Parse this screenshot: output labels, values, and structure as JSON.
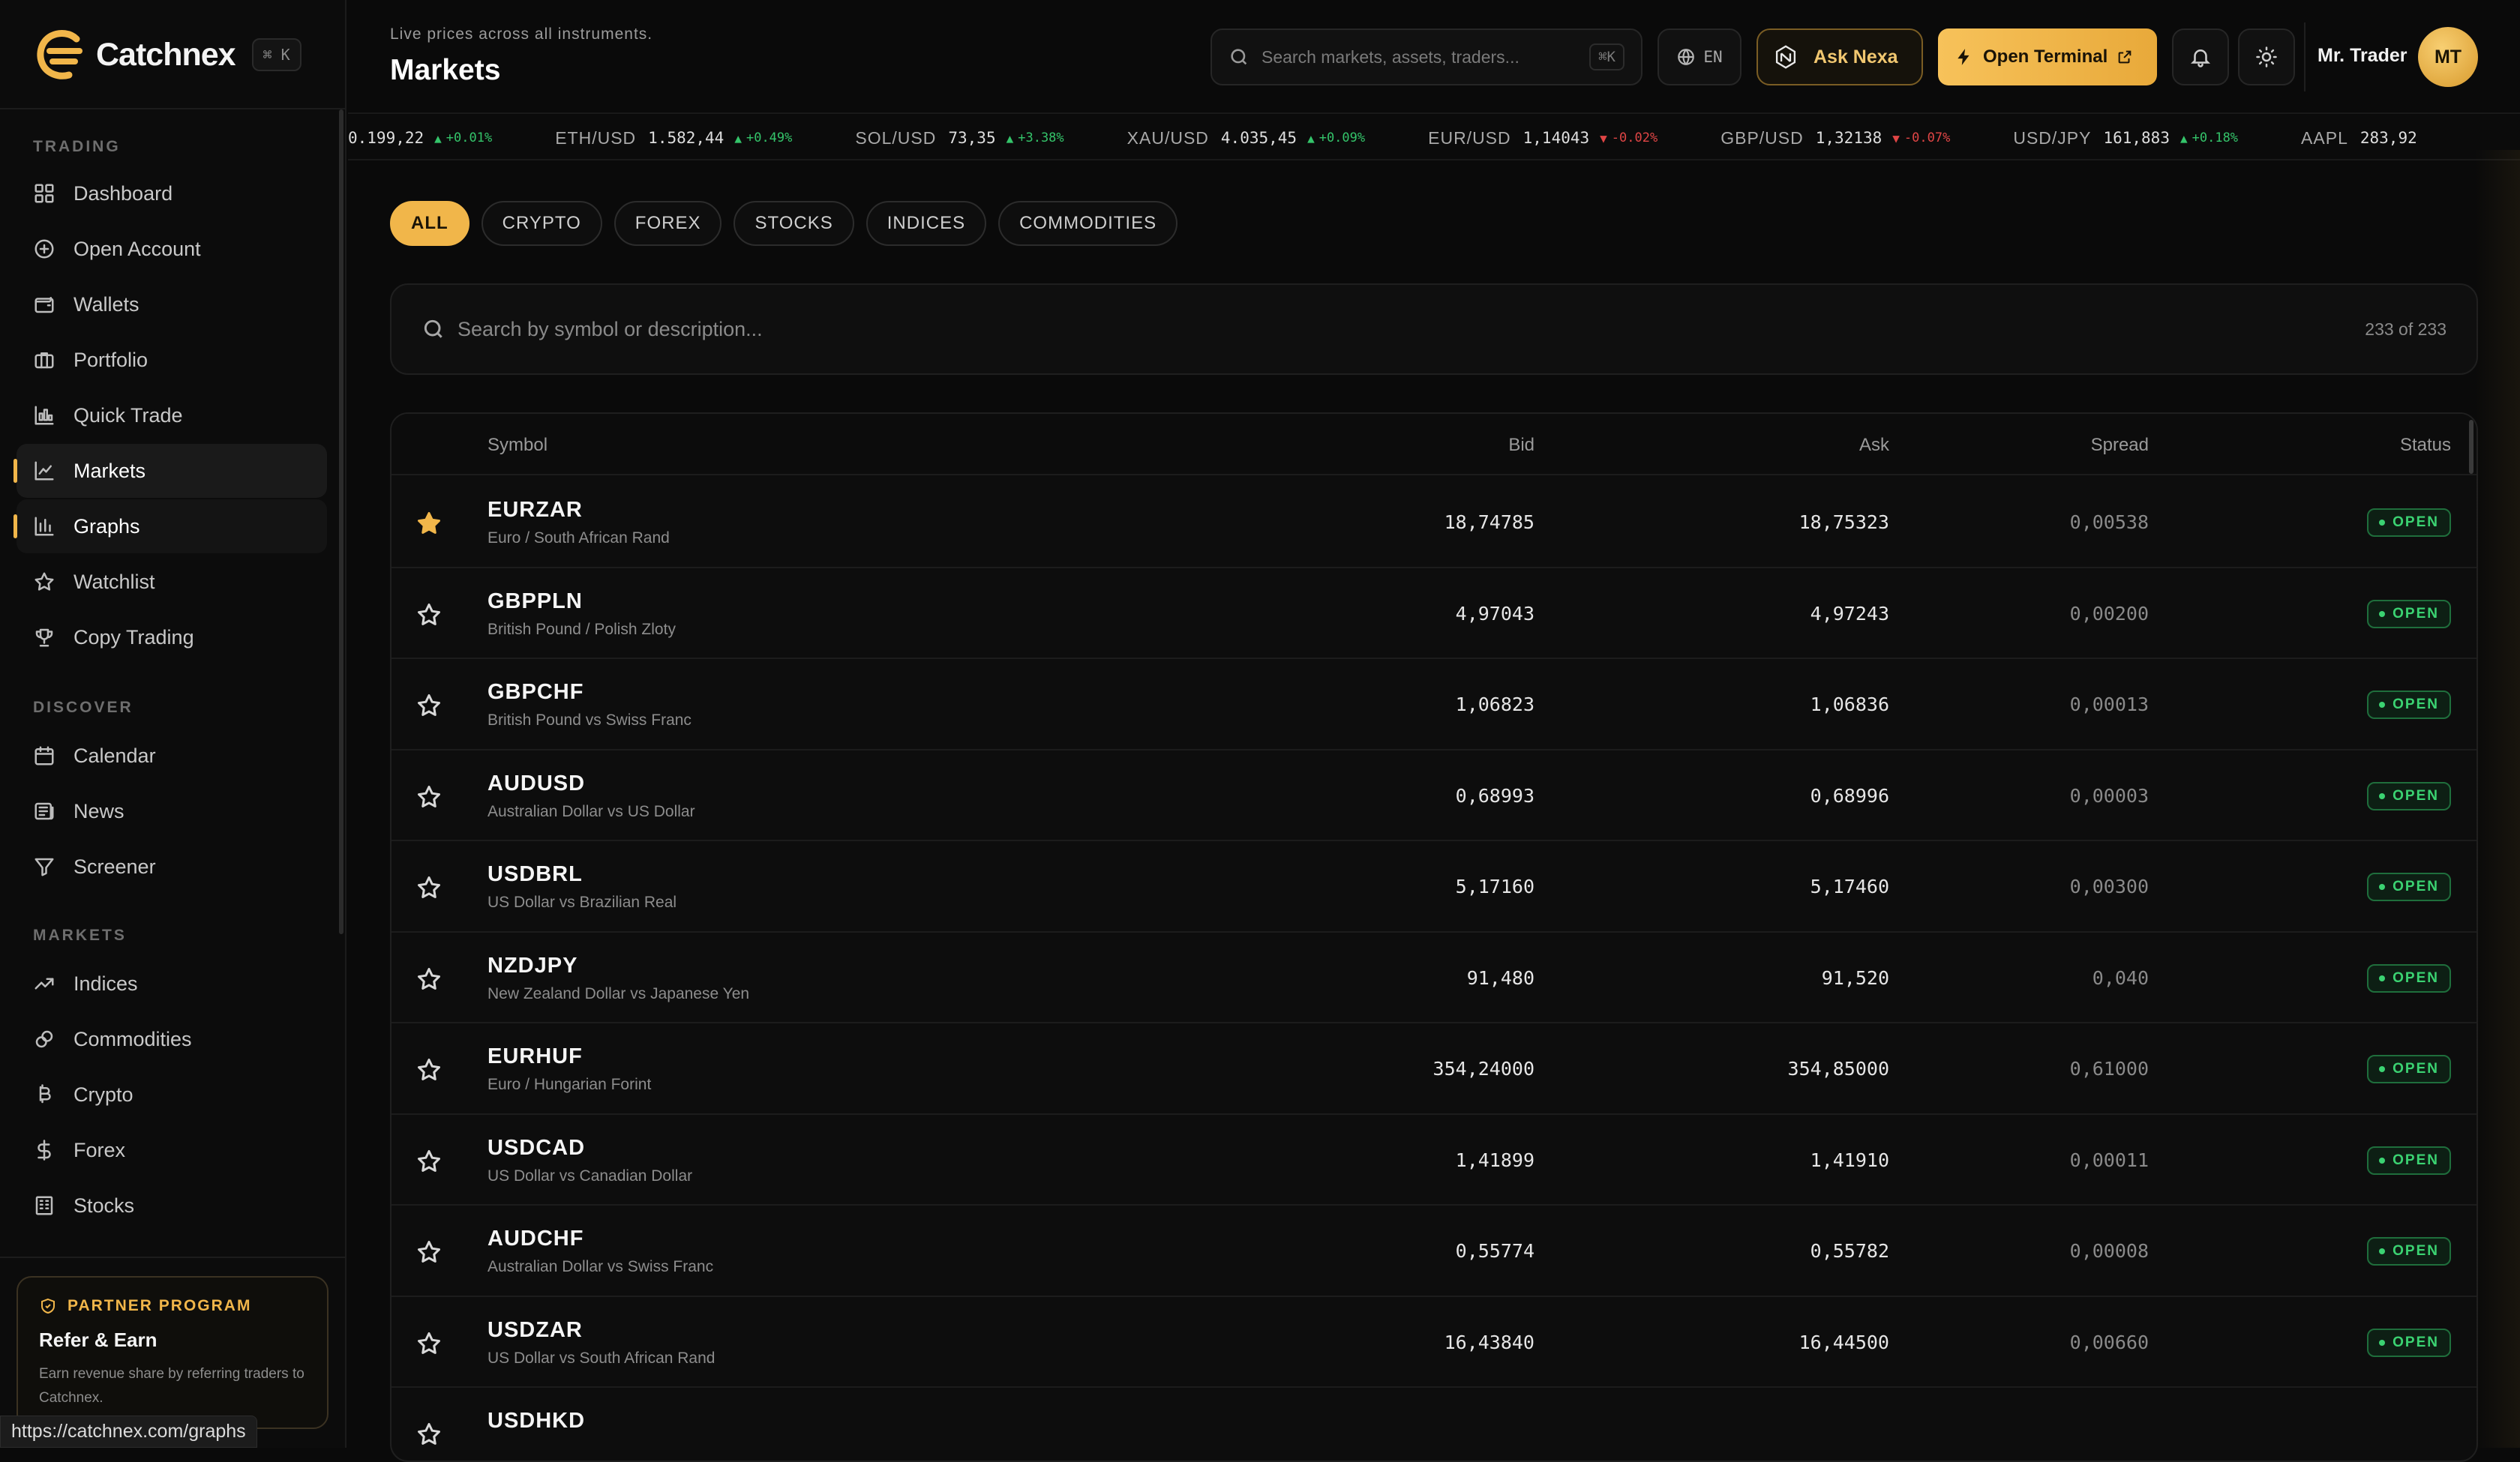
{
  "brand": {
    "name": "Catchnex",
    "shortcut": "⌘ K"
  },
  "sidebar": {
    "sections": [
      {
        "title": "TRADING",
        "items": [
          {
            "label": "Dashboard",
            "icon": "dashboard-grid-icon"
          },
          {
            "label": "Open Account",
            "icon": "plus-circle-icon"
          },
          {
            "label": "Wallets",
            "icon": "wallet-icon"
          },
          {
            "label": "Portfolio",
            "icon": "briefcase-icon"
          },
          {
            "label": "Quick Trade",
            "icon": "bars-chart-icon"
          },
          {
            "label": "Markets",
            "icon": "line-chart-icon",
            "state": "active"
          },
          {
            "label": "Graphs",
            "icon": "bar-chart-icon",
            "state": "hover"
          },
          {
            "label": "Watchlist",
            "icon": "star-icon"
          },
          {
            "label": "Copy Trading",
            "icon": "trophy-icon"
          }
        ]
      },
      {
        "title": "DISCOVER",
        "items": [
          {
            "label": "Calendar",
            "icon": "calendar-icon"
          },
          {
            "label": "News",
            "icon": "newspaper-icon"
          },
          {
            "label": "Screener",
            "icon": "filter-icon"
          }
        ]
      },
      {
        "title": "MARKETS",
        "items": [
          {
            "label": "Indices",
            "icon": "trending-up-icon"
          },
          {
            "label": "Commodities",
            "icon": "link-icon"
          },
          {
            "label": "Crypto",
            "icon": "bitcoin-icon"
          },
          {
            "label": "Forex",
            "icon": "dollar-icon"
          },
          {
            "label": "Stocks",
            "icon": "building-icon"
          }
        ]
      }
    ],
    "partner": {
      "badge": "PARTNER PROGRAM",
      "title": "Refer & Earn",
      "description": "Earn revenue share by referring traders to Catchnex."
    }
  },
  "statusbar": {
    "url": "https://catchnex.com/graphs"
  },
  "header": {
    "subtitle": "Live prices across all instruments.",
    "title": "Markets",
    "search_placeholder": "Search markets, assets, traders...",
    "search_shortcut": "⌘K",
    "language": "EN",
    "ask_label": "Ask Nexa",
    "terminal_label": "Open Terminal",
    "user_name": "Mr. Trader",
    "user_initials": "MT"
  },
  "ticker": [
    {
      "symbol": "",
      "price": "0.199,22",
      "change": "+0.01%",
      "dir": "up"
    },
    {
      "symbol": "ETH/USD",
      "price": "1.582,44",
      "change": "+0.49%",
      "dir": "up"
    },
    {
      "symbol": "SOL/USD",
      "price": "73,35",
      "change": "+3.38%",
      "dir": "up"
    },
    {
      "symbol": "XAU/USD",
      "price": "4.035,45",
      "change": "+0.09%",
      "dir": "up"
    },
    {
      "symbol": "EUR/USD",
      "price": "1,14043",
      "change": "-0.02%",
      "dir": "down"
    },
    {
      "symbol": "GBP/USD",
      "price": "1,32138",
      "change": "-0.07%",
      "dir": "down"
    },
    {
      "symbol": "USD/JPY",
      "price": "161,883",
      "change": "+0.18%",
      "dir": "up"
    },
    {
      "symbol": "AAPL",
      "price": "283,92",
      "change": "",
      "dir": ""
    }
  ],
  "filters": {
    "chips": [
      "ALL",
      "CRYPTO",
      "FOREX",
      "STOCKS",
      "INDICES",
      "COMMODITIES"
    ],
    "active": "ALL",
    "search_placeholder": "Search by symbol or description...",
    "count": "233 of 233"
  },
  "table": {
    "columns": {
      "symbol": "Symbol",
      "bid": "Bid",
      "ask": "Ask",
      "spread": "Spread",
      "status": "Status"
    },
    "rows": [
      {
        "symbol": "EURZAR",
        "description": "Euro / South African Rand",
        "bid": "18,74785",
        "ask": "18,75323",
        "spread": "0,00538",
        "status": "OPEN",
        "favorite": true
      },
      {
        "symbol": "GBPPLN",
        "description": "British Pound / Polish Zloty",
        "bid": "4,97043",
        "ask": "4,97243",
        "spread": "0,00200",
        "status": "OPEN",
        "favorite": false
      },
      {
        "symbol": "GBPCHF",
        "description": "British Pound vs Swiss Franc",
        "bid": "1,06823",
        "ask": "1,06836",
        "spread": "0,00013",
        "status": "OPEN",
        "favorite": false
      },
      {
        "symbol": "AUDUSD",
        "description": "Australian Dollar vs US Dollar",
        "bid": "0,68993",
        "ask": "0,68996",
        "spread": "0,00003",
        "status": "OPEN",
        "favorite": false
      },
      {
        "symbol": "USDBRL",
        "description": "US Dollar vs Brazilian Real",
        "bid": "5,17160",
        "ask": "5,17460",
        "spread": "0,00300",
        "status": "OPEN",
        "favorite": false
      },
      {
        "symbol": "NZDJPY",
        "description": "New Zealand Dollar vs Japanese Yen",
        "bid": "91,480",
        "ask": "91,520",
        "spread": "0,040",
        "status": "OPEN",
        "favorite": false
      },
      {
        "symbol": "EURHUF",
        "description": "Euro / Hungarian Forint",
        "bid": "354,24000",
        "ask": "354,85000",
        "spread": "0,61000",
        "status": "OPEN",
        "favorite": false
      },
      {
        "symbol": "USDCAD",
        "description": "US Dollar vs Canadian Dollar",
        "bid": "1,41899",
        "ask": "1,41910",
        "spread": "0,00011",
        "status": "OPEN",
        "favorite": false
      },
      {
        "symbol": "AUDCHF",
        "description": "Australian Dollar vs Swiss Franc",
        "bid": "0,55774",
        "ask": "0,55782",
        "spread": "0,00008",
        "status": "OPEN",
        "favorite": false
      },
      {
        "symbol": "USDZAR",
        "description": "US Dollar vs South African Rand",
        "bid": "16,43840",
        "ask": "16,44500",
        "spread": "0,00660",
        "status": "OPEN",
        "favorite": false
      },
      {
        "symbol": "USDHKD",
        "description": "",
        "bid": "",
        "ask": "",
        "spread": "",
        "status": "",
        "favorite": false
      }
    ]
  },
  "colors": {
    "accent": "#f1b64a",
    "positive": "#34c46a",
    "negative": "#e04545",
    "background": "#0a0a0a"
  }
}
